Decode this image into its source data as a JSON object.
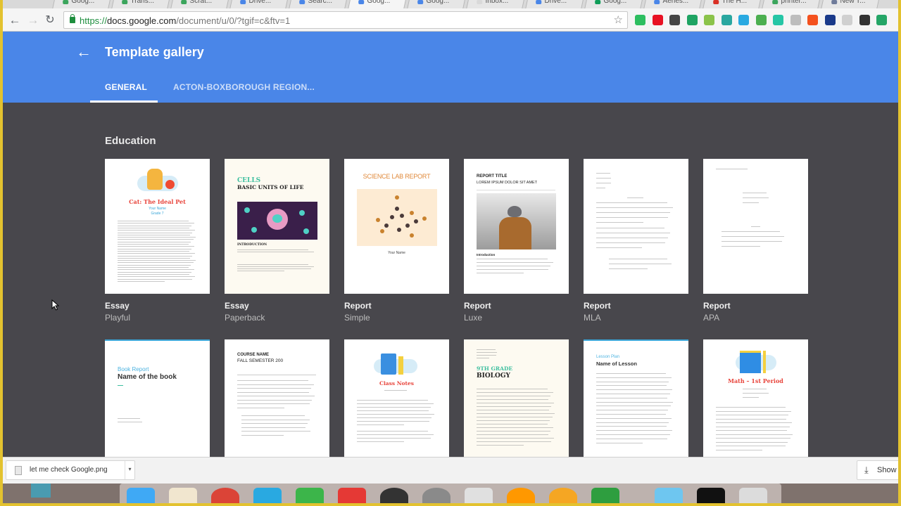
{
  "browser": {
    "tabs": [
      {
        "title": "Goog...",
        "favicon": "google-g",
        "color": "#3ba55c"
      },
      {
        "title": "Trans...",
        "favicon": "google-g",
        "color": "#3ba55c"
      },
      {
        "title": "Scrat...",
        "favicon": "google-g",
        "color": "#3ba55c"
      },
      {
        "title": "Drive...",
        "favicon": "docs",
        "color": "#4a86e8"
      },
      {
        "title": "Searc...",
        "favicon": "docs",
        "color": "#4a86e8"
      },
      {
        "title": "Goog...",
        "favicon": "docs",
        "color": "#4a86e8",
        "active": true
      },
      {
        "title": "Goog...",
        "favicon": "docs",
        "color": "#4a86e8"
      },
      {
        "title": "Inbox...",
        "favicon": "mail",
        "color": "#d9d9d9"
      },
      {
        "title": "Drive...",
        "favicon": "docs",
        "color": "#4a86e8"
      },
      {
        "title": "Goog...",
        "favicon": "sheets",
        "color": "#0f9d58"
      },
      {
        "title": "Aeries...",
        "favicon": "a",
        "color": "#4a86e8"
      },
      {
        "title": "The H...",
        "favicon": "red",
        "color": "#d93025"
      },
      {
        "title": "printer...",
        "favicon": "google-g",
        "color": "#3ba55c"
      },
      {
        "title": "New T...",
        "favicon": "doc",
        "color": "#6f7b9a"
      }
    ],
    "url": {
      "scheme": "https://",
      "host": "docs.google.com",
      "path": "/document/u/0/?tgif=c&ftv=1"
    },
    "extensions": [
      {
        "name": "evernote-icon",
        "color": "#2dbe60"
      },
      {
        "name": "opera-icon",
        "color": "#e81123"
      },
      {
        "name": "film-icon",
        "color": "#444444"
      },
      {
        "name": "google-drive-icon",
        "color": "#1fa463"
      },
      {
        "name": "clipboard-icon",
        "color": "#8bc34a"
      },
      {
        "name": "arrow-up-icon",
        "color": "#2aa7a0"
      },
      {
        "name": "d-icon",
        "color": "#29a9e1"
      },
      {
        "name": "download-icon",
        "color": "#4caf50"
      },
      {
        "name": "save-icon",
        "color": "#26c6a6"
      },
      {
        "name": "cloud-icon",
        "color": "#bdbdbd"
      },
      {
        "name": "highlighter-icon",
        "color": "#f4511e"
      },
      {
        "name": "n-icon",
        "color": "#1a3a8a"
      },
      {
        "name": "page-icon",
        "color": "#d0d0d0"
      },
      {
        "name": "pin-icon",
        "color": "#333333"
      },
      {
        "name": "classroom-icon",
        "color": "#25a667"
      }
    ]
  },
  "header": {
    "title": "Template gallery",
    "tabs": [
      {
        "label": "GENERAL",
        "active": true
      },
      {
        "label": "ACTON-BOXBOROUGH REGION...",
        "active": false
      }
    ]
  },
  "section": {
    "title": "Education",
    "row1": [
      {
        "type": "Essay",
        "style": "Playful",
        "heading": "Cat: The Ideal Pet",
        "sub1": "Your Name",
        "sub2": "Grade 7"
      },
      {
        "type": "Essay",
        "style": "Paperback",
        "heading1": "CELLS",
        "heading2": "BASIC UNITS OF LIFE",
        "section": "INTRODUCTION"
      },
      {
        "type": "Report",
        "style": "Simple",
        "heading": "SCIENCE LAB REPORT",
        "sub1": "Your Name"
      },
      {
        "type": "Report",
        "style": "Luxe",
        "heading1": "REPORT TITLE",
        "heading2": "LOREM IPSUM DOLOR SIT AMET",
        "section": "Introduction"
      },
      {
        "type": "Report",
        "style": "MLA"
      },
      {
        "type": "Report",
        "style": "APA"
      }
    ],
    "row2": [
      {
        "heading1": "Book Report",
        "heading2": "Name of the book"
      },
      {
        "heading1": "COURSE NAME",
        "heading2": "FALL SEMESTER 200"
      },
      {
        "heading": "Class Notes"
      },
      {
        "heading1": "9TH GRADE",
        "heading2": "BIOLOGY"
      },
      {
        "heading1": "Lesson Plan",
        "heading2": "Name of Lesson"
      },
      {
        "heading": "Math – 1st Period"
      }
    ]
  },
  "download_bar": {
    "file_name": "let me check Google.png",
    "show_all_label": "Show All"
  },
  "dock": {
    "apps": [
      {
        "name": "finder-icon",
        "color": "#3fa9f5"
      },
      {
        "name": "no-sign-app-icon",
        "color": "#f1e6cf"
      },
      {
        "name": "chrome-icon",
        "color": "#db4437"
      },
      {
        "name": "w-app-icon",
        "color": "#29a9e1"
      },
      {
        "name": "x-app-icon",
        "color": "#3cb54a"
      },
      {
        "name": "red-app-icon",
        "color": "#e53935"
      },
      {
        "name": "far-app-icon",
        "color": "#333333"
      },
      {
        "name": "system-preferences-icon",
        "color": "#8a8a8a"
      },
      {
        "name": "screens-app-icon",
        "color": "#e0e0e0"
      },
      {
        "name": "photos-icon",
        "color": "#ff9800"
      },
      {
        "name": "messenger-app-icon",
        "color": "#f5a623"
      },
      {
        "name": "green-app-icon",
        "color": "#2e9e3f"
      },
      {
        "name": "downloads-folder-icon",
        "color": "#6ec6f0"
      },
      {
        "name": "terminal-icon",
        "color": "#111111"
      },
      {
        "name": "trash-icon",
        "color": "#dcdcdc"
      }
    ]
  }
}
